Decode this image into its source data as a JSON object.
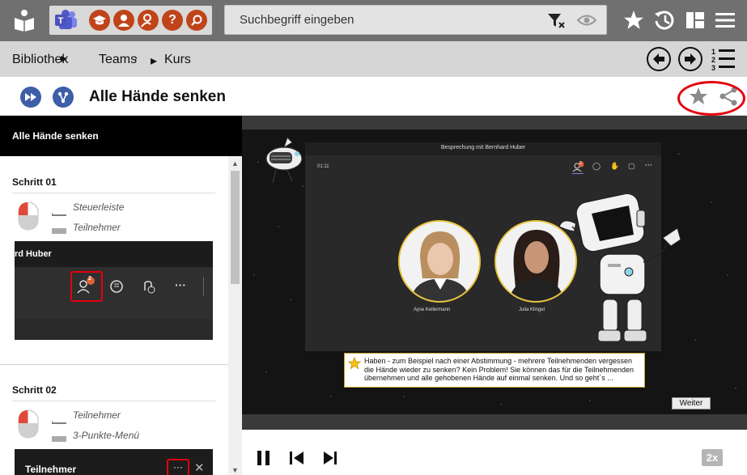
{
  "search": {
    "placeholder": "Suchbegriff eingeben"
  },
  "breadcrumb": [
    "Bibliothek",
    "Teams",
    "Kurs"
  ],
  "page": {
    "title": "Alle Hände senken"
  },
  "sidebar": {
    "header": "Alle Hände senken",
    "steps": [
      {
        "title": "Schritt 01",
        "hints": [
          "Steuerleiste",
          "Teilnehmer"
        ],
        "preview": {
          "caption": "rd Huber",
          "badge": "2"
        }
      },
      {
        "title": "Schritt 02",
        "hints": [
          "Teilnehmer",
          "3-Punkte-Menü"
        ],
        "preview": {
          "caption": "Teilnehmer"
        }
      }
    ]
  },
  "meeting": {
    "title": "Besprechung mit Bernhard Huber",
    "time": "01:11",
    "badge": "2",
    "participants": [
      {
        "name": "Ayse Kellermann"
      },
      {
        "name": "Julia Klingel"
      }
    ]
  },
  "tooltip": {
    "text": "Haben - zum Beispiel nach einer Abstimmung - mehrere Teilnehmenden vergessen die Hände wieder zu senken? Kein Problem! Sie können das für die Teilnehmenden übernehmen und alle gehobenen Hände auf einmal senken. Und so geht´s ..."
  },
  "controls": {
    "next_label": "Weiter",
    "speed_label": "2x"
  },
  "colors": {
    "accent_red": "#e3000f",
    "brand_orange": "#c0441a",
    "title_blue": "#3e5ea8",
    "highlight_yellow": "#e8c43a"
  }
}
